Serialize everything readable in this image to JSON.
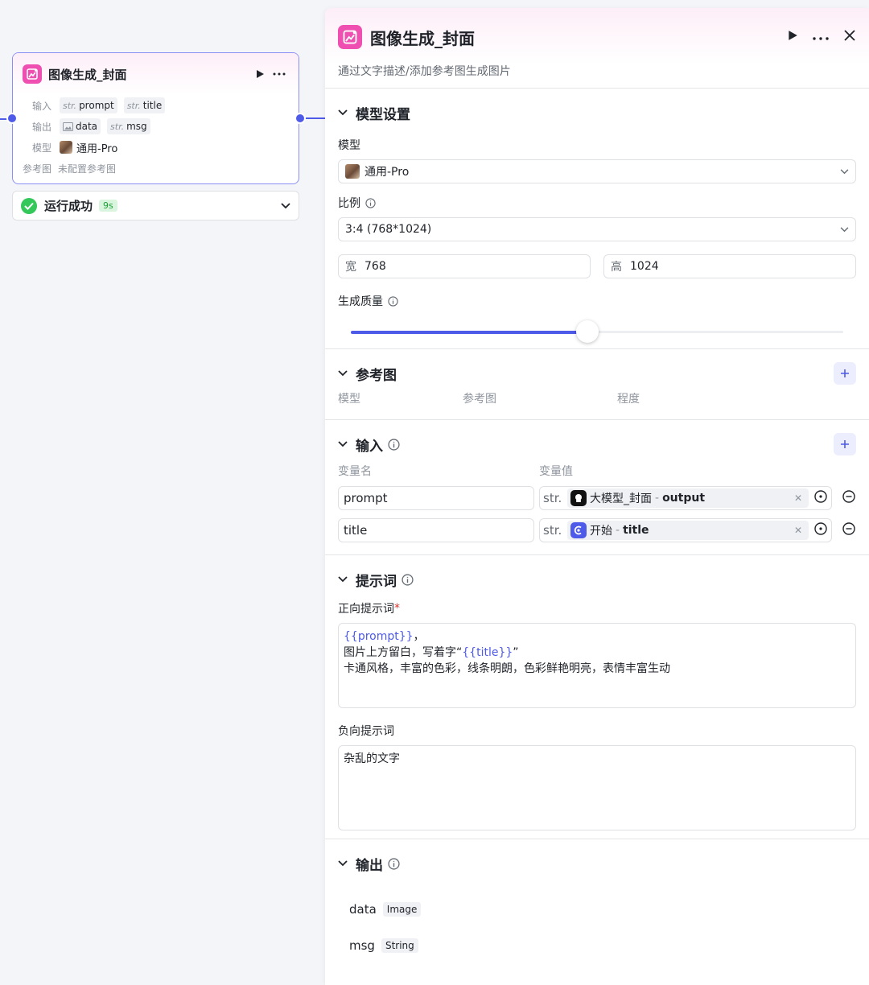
{
  "node": {
    "title": "图像生成_封面",
    "input_label": "输入",
    "output_label": "输出",
    "model_label": "模型",
    "ref_label": "参考图",
    "type_prefix": "str.",
    "inputs": [
      "prompt",
      "title"
    ],
    "outputs": [
      {
        "type_icon": "image-icon",
        "name": "data"
      },
      {
        "type_prefix": "str.",
        "name": "msg"
      }
    ],
    "model": "通用-Pro",
    "ref_value": "未配置参考图"
  },
  "run_status": {
    "text": "运行成功",
    "time": "9s"
  },
  "panel": {
    "title": "图像生成_封面",
    "description": "通过文字描述/添加参考图生成图片",
    "model_settings": {
      "title": "模型设置",
      "model_label": "模型",
      "model_value": "通用-Pro",
      "ratio_label": "比例",
      "ratio_value": "3:4 (768*1024)",
      "width_prefix": "宽",
      "width_value": "768",
      "height_prefix": "高",
      "height_value": "1024",
      "quality_label": "生成质量",
      "quality_level": 0.48
    },
    "reference": {
      "title": "参考图",
      "columns": [
        "模型",
        "参考图",
        "程度"
      ]
    },
    "inputs": {
      "title": "输入",
      "col_name": "变量名",
      "col_value": "变量值",
      "rows": [
        {
          "name": "prompt",
          "type": "str.",
          "ref_node": "大模型_封面",
          "sep": "-",
          "ref_var": "output"
        },
        {
          "name": "title",
          "type": "str.",
          "ref_node": "开始",
          "sep": "-",
          "ref_var": "title"
        }
      ]
    },
    "prompt": {
      "title": "提示词",
      "positive_label": "正向提示词",
      "required_mark": "*",
      "positive_line1_var": "{{prompt}}",
      "positive_line1_rest": "，",
      "positive_line2_pre": "图片上方留白，写着字“",
      "positive_line2_var": "{{title}}",
      "positive_line2_post": "”",
      "positive_line3": "卡通风格，丰富的色彩，线条明朗，色彩鲜艳明亮，表情丰富生动",
      "negative_label": "负向提示词",
      "negative_value": "杂乱的文字"
    },
    "outputs": {
      "title": "输出",
      "rows": [
        {
          "name": "data",
          "type": "Image"
        },
        {
          "name": "msg",
          "type": "String"
        }
      ]
    }
  },
  "colors": {
    "accent": "#4e5ae8",
    "brand_pink": "#ee4fb1",
    "success": "#34c759"
  }
}
